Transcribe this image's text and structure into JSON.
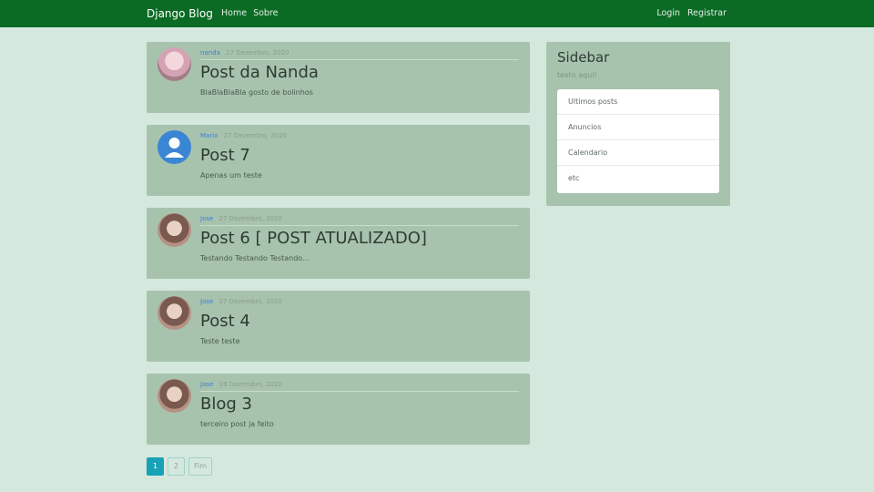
{
  "nav": {
    "brand": "Django Blog",
    "left_links": [
      "Home",
      "Sobre"
    ],
    "right_links": [
      "Login",
      "Registrar"
    ]
  },
  "posts": [
    {
      "author": "nanda",
      "date": "27 Dezembro, 2020",
      "title": "Post da Nanda",
      "excerpt": "BlaBlaBlaBla gosto de bolinhos",
      "avatar": "anime-avatar"
    },
    {
      "author": "Mario",
      "date": "27 Dezembro, 2020",
      "title": "Post 7",
      "excerpt": "Apenas um teste",
      "avatar": "default-user-avatar"
    },
    {
      "author": "Jose",
      "date": "27 Dezembro, 2020",
      "title": "Post 6 [ POST ATUALIZADO]",
      "excerpt": "Testando Testando Testando...",
      "avatar": "brown-hair-avatar"
    },
    {
      "author": "Jose",
      "date": "27 Dezembro, 2020",
      "title": "Post 4",
      "excerpt": "Teste teste",
      "avatar": "brown-hair-avatar"
    },
    {
      "author": "Jose",
      "date": "18 Dezembro, 2020",
      "title": "Blog 3",
      "excerpt": "terceiro post ja feito",
      "avatar": "brown-hair-avatar"
    }
  ],
  "sidebar": {
    "title": "Sidebar",
    "text": "texto aqui!",
    "items": [
      "Ultimos posts",
      "Anuncios",
      "Calendario",
      "etc"
    ]
  },
  "pagination": {
    "pages": [
      "1",
      "2",
      "Fim"
    ],
    "active": "1"
  },
  "colors": {
    "navbar": "#0b6b25",
    "page_bg": "#d5e8dd",
    "card_bg": "#a7c3ae",
    "link": "#3c7ddc",
    "active_page": "#17a2b8"
  }
}
